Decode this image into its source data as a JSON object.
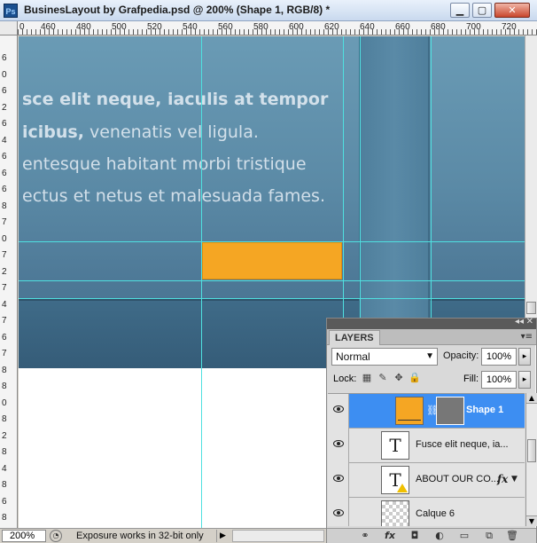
{
  "window": {
    "title": "BusinesLayout by Grafpedia.psd @ 200% (Shape 1, RGB/8) *",
    "app_icon_text": "Ps",
    "minimize_label": "▁",
    "maximize_label": "▢",
    "close_label": "✕"
  },
  "ruler": {
    "top_labels": [
      "0",
      "460",
      "480",
      "500",
      "520",
      "540",
      "560",
      "580",
      "600",
      "620",
      "640",
      "660",
      "680",
      "700",
      "720"
    ],
    "left_labels": [
      "6",
      "0",
      "6",
      "2",
      "6",
      "4",
      "6",
      "6",
      "6",
      "8",
      "7",
      "0",
      "7",
      "2",
      "7",
      "4",
      "7",
      "6",
      "7",
      "8",
      "8",
      "0",
      "8",
      "2",
      "8",
      "4",
      "8",
      "6",
      "8",
      "8"
    ]
  },
  "canvas": {
    "hero_text": {
      "line1": "sce elit neque, iaculis at tempor",
      "line2_bold": "icibus,",
      "line2_rest": " venenatis vel ligula.",
      "line3": "entesque habitant morbi tristique",
      "line4": "ectus et netus et malesuada fames."
    },
    "shape_color": "#f5a623",
    "guide_color": "#4fe0e0"
  },
  "layers_panel": {
    "collapse_glyph": "◂◂",
    "close_glyph": "✕",
    "tab_label": "LAYERS",
    "menu_glyph": "▾≡",
    "blend_mode": "Normal",
    "opacity_label": "Opacity:",
    "opacity_value": "100%",
    "lock_label": "Lock:",
    "fill_label": "Fill:",
    "fill_value": "100%",
    "flyout_glyph": "▸",
    "layers": [
      {
        "name": "Shape 1",
        "selected": true,
        "thumb_color": "#f5a623"
      },
      {
        "name": "Fusce elit neque, ia...",
        "type_glyph": "T"
      },
      {
        "name": "ABOUT OUR CO...",
        "type_glyph": "T",
        "fx": "fx"
      },
      {
        "name": "Calque 6"
      }
    ],
    "footer_icons": [
      "link-icon",
      "fx-icon",
      "mask-icon",
      "adjustment-icon",
      "group-icon",
      "new-layer-icon",
      "trash-icon"
    ],
    "footer_glyphs": [
      "⚭",
      "fx",
      "◘",
      "◐",
      "▭",
      "⧉",
      "🗑"
    ]
  },
  "status_bar": {
    "zoom": "200%",
    "message": "Exposure works in 32-bit only",
    "arrow": "▶"
  }
}
